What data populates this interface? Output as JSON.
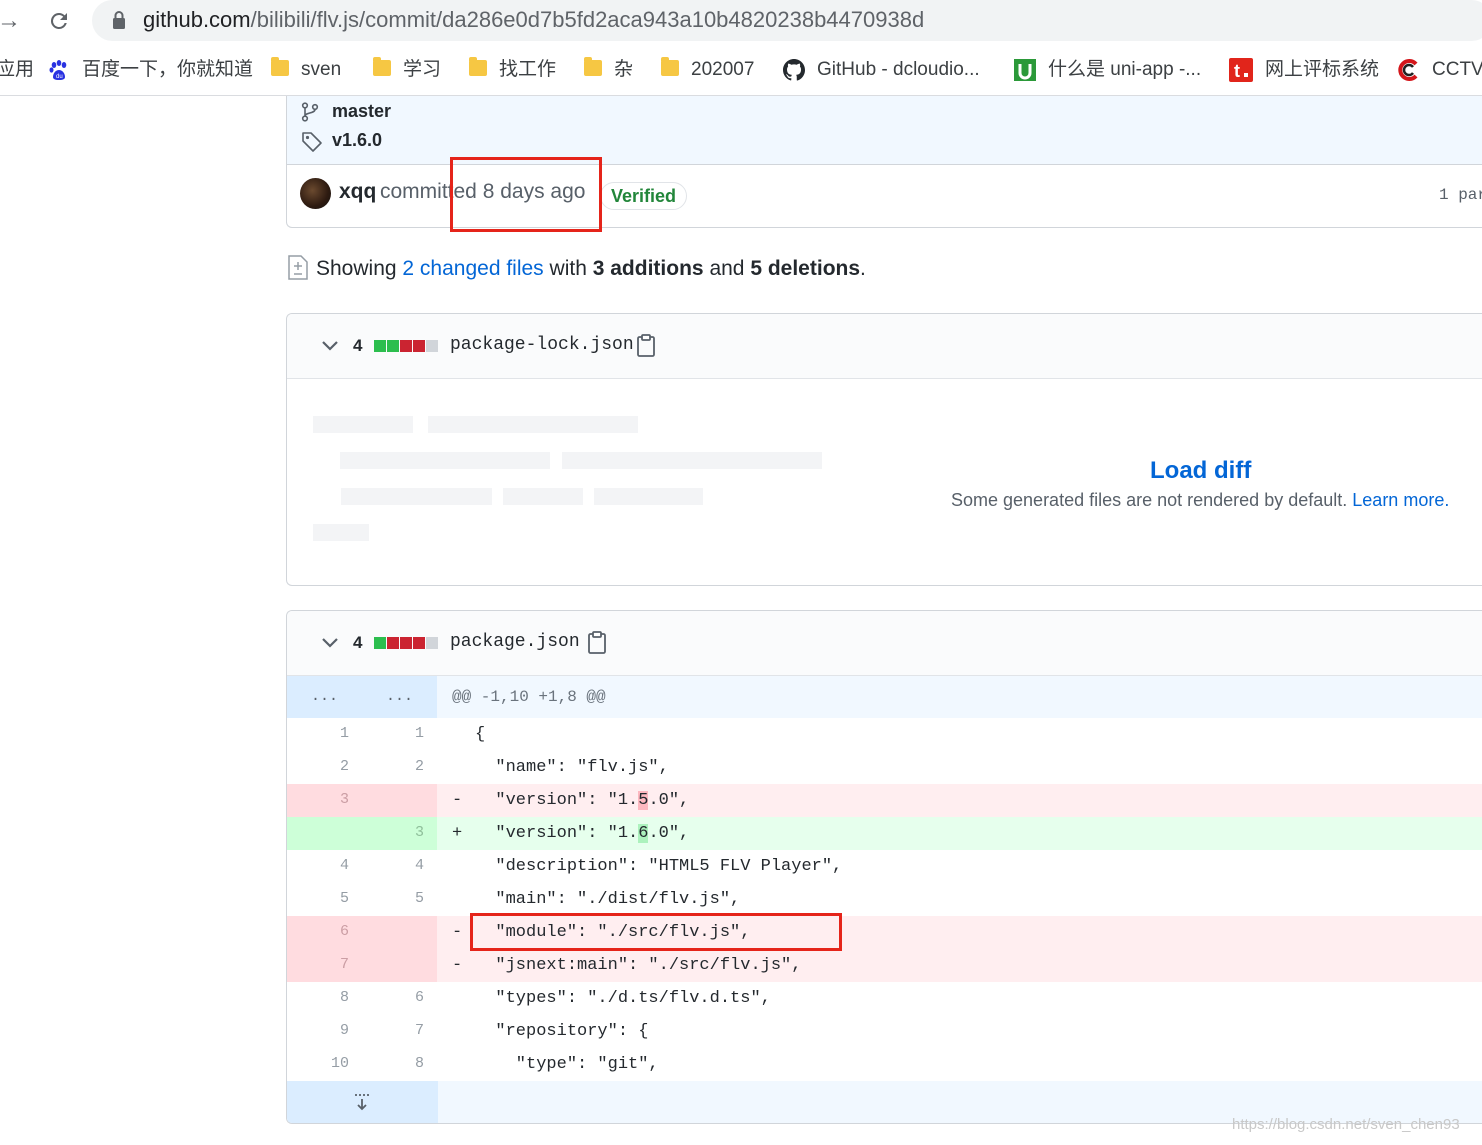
{
  "browser": {
    "url_host": "github.com",
    "url_path": "/bilibili/flv.js/commit/da286e0d7b5fd2aca943a10b4820238b4470938d",
    "bookmarks": [
      {
        "label": "应用",
        "icon": "apps-icon"
      },
      {
        "label": "百度一下，你就知道",
        "icon": "baidu-paw-icon"
      },
      {
        "label": "sven",
        "icon": "folder-icon"
      },
      {
        "label": "学习",
        "icon": "folder-icon"
      },
      {
        "label": "找工作",
        "icon": "folder-icon"
      },
      {
        "label": "杂",
        "icon": "folder-icon"
      },
      {
        "label": "202007",
        "icon": "folder-icon"
      },
      {
        "label": "GitHub - dcloudio...",
        "icon": "github-icon"
      },
      {
        "label": "什么是 uni-app -...",
        "icon": "uniapp-icon"
      },
      {
        "label": "网上评标系统",
        "icon": "t-logo-icon"
      },
      {
        "label": "CCTV-",
        "icon": "cctv-icon"
      }
    ]
  },
  "commit": {
    "branch": "master",
    "tag": "v1.6.0",
    "author": "xqq",
    "committed_text": "committed 8 days ago",
    "verified_label": "Verified",
    "parent_text": "1 par"
  },
  "summary": {
    "prefix": "Showing",
    "changed_files": "2 changed files",
    "with": "with",
    "additions": "3 additions",
    "and": "and",
    "deletions": "5 deletions",
    "suffix": "."
  },
  "files": [
    {
      "count": "4",
      "filename": "package-lock.json",
      "load_diff_label": "Load diff",
      "note": "Some generated files are not rendered by default.",
      "learn_more": "Learn more."
    },
    {
      "count": "4",
      "filename": "package.json",
      "hunk_old": "...",
      "hunk_new": "...",
      "hunk_header": "@@ -1,10 +1,8 @@",
      "lines": [
        {
          "type": "ctx",
          "old": "1",
          "new": "1",
          "marker": " ",
          "pre": "{",
          "hl": "",
          "post": ""
        },
        {
          "type": "ctx",
          "old": "2",
          "new": "2",
          "marker": " ",
          "pre": "  \"name\": \"flv.js\",",
          "hl": "",
          "post": ""
        },
        {
          "type": "del",
          "old": "3",
          "new": "",
          "marker": "-",
          "pre": "  \"version\": \"1.",
          "hl": "5",
          "post": ".0\","
        },
        {
          "type": "add",
          "old": "",
          "new": "3",
          "marker": "+",
          "pre": "  \"version\": \"1.",
          "hl": "6",
          "post": ".0\","
        },
        {
          "type": "ctx",
          "old": "4",
          "new": "4",
          "marker": " ",
          "pre": "  \"description\": \"HTML5 FLV Player\",",
          "hl": "",
          "post": ""
        },
        {
          "type": "ctx",
          "old": "5",
          "new": "5",
          "marker": " ",
          "pre": "  \"main\": \"./dist/flv.js\",",
          "hl": "",
          "post": ""
        },
        {
          "type": "del",
          "old": "6",
          "new": "",
          "marker": "-",
          "pre": "  \"module\": \"./src/flv.js\",",
          "hl": "",
          "post": ""
        },
        {
          "type": "del",
          "old": "7",
          "new": "",
          "marker": "-",
          "pre": "  \"jsnext:main\": \"./src/flv.js\",",
          "hl": "",
          "post": ""
        },
        {
          "type": "ctx",
          "old": "8",
          "new": "6",
          "marker": " ",
          "pre": "  \"types\": \"./d.ts/flv.d.ts\",",
          "hl": "",
          "post": ""
        },
        {
          "type": "ctx",
          "old": "9",
          "new": "7",
          "marker": " ",
          "pre": "  \"repository\": {",
          "hl": "",
          "post": ""
        },
        {
          "type": "ctx",
          "old": "10",
          "new": "8",
          "marker": " ",
          "pre": "    \"type\": \"git\",",
          "hl": "",
          "post": ""
        }
      ]
    }
  ],
  "watermark": "https://blog.csdn.net/sven_chen93",
  "colors": {
    "link": "#0366d6",
    "verified": "#22863a",
    "annotation_box": "#e5241a",
    "del_bg": "#ffeef0",
    "add_bg": "#e6ffed"
  }
}
